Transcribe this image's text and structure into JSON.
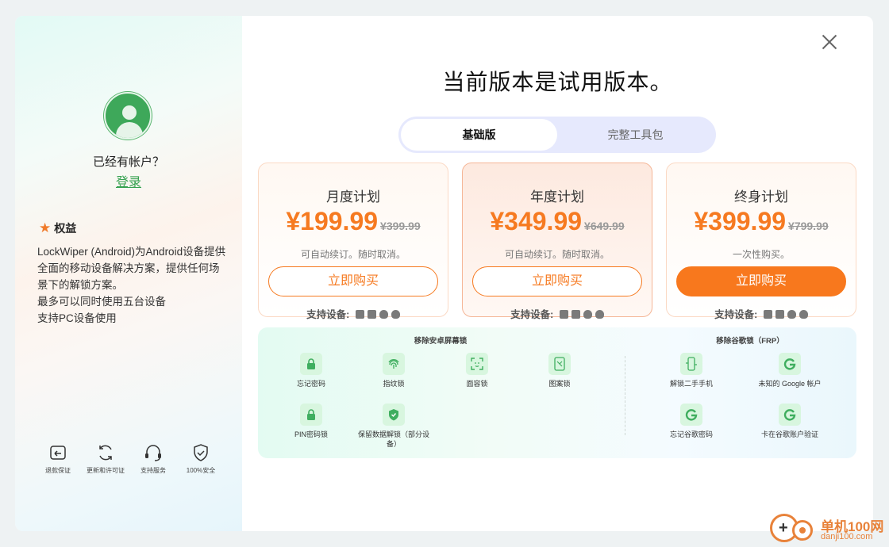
{
  "sidebar": {
    "has_account": "已经有帐户？",
    "login": "登录",
    "benefits_title": "权益",
    "benefits_lines": [
      "LockWiper (Android)为Android设备提供全面的移动设备解决方案，提供任何场景下的解锁方案。",
      "最多可以同时使用五台设备",
      "支持PC设备使用"
    ],
    "features": [
      {
        "label": "退款保证",
        "icon": "refund-icon"
      },
      {
        "label": "更新和许可证",
        "icon": "refresh-icon"
      },
      {
        "label": "支持服务",
        "icon": "headset-icon"
      },
      {
        "label": "100%安全",
        "icon": "shield-icon"
      }
    ]
  },
  "main": {
    "title": "当前版本是试用版本。",
    "tabs": [
      {
        "label": "基础版",
        "active": true
      },
      {
        "label": "完整工具包",
        "active": false
      }
    ],
    "devices_label": "支持设备:",
    "plans": [
      {
        "name": "月度计划",
        "price": "¥199.99",
        "old_price": "¥399.99",
        "note": "可自动续订。随时取消。",
        "button": "立即购买"
      },
      {
        "name": "年度计划",
        "price": "¥349.99",
        "old_price": "¥649.99",
        "note": "可自动续订。随时取消。",
        "button": "立即购买"
      },
      {
        "name": "终身计划",
        "price": "¥399.99",
        "old_price": "¥799.99",
        "note": "一次性购买。",
        "button": "立即购买"
      }
    ],
    "unlock": {
      "left_title": "移除安卓屏幕锁",
      "right_title": "移除谷歌锁（FRP）",
      "left_items": [
        {
          "label": "忘记密码",
          "icon": "lock-icon"
        },
        {
          "label": "指纹锁",
          "icon": "fingerprint-icon"
        },
        {
          "label": "面容锁",
          "icon": "face-scan-icon"
        },
        {
          "label": "图案锁",
          "icon": "pattern-icon"
        },
        {
          "label": "PIN密码锁",
          "icon": "pin-lock-icon"
        },
        {
          "label": "保留数据解锁（部分设备）",
          "icon": "shield-check-icon"
        }
      ],
      "right_items": [
        {
          "label": "解锁二手手机",
          "icon": "phone-icon"
        },
        {
          "label": "未知的 Google 帐户",
          "icon": "google-account-icon"
        },
        {
          "label": "忘记谷歌密码",
          "icon": "google-reset-icon"
        },
        {
          "label": "卡在谷歌账户验证",
          "icon": "google-icon"
        }
      ]
    }
  },
  "watermark": {
    "name": "单机100网",
    "url": "danji100.com"
  },
  "colors": {
    "accent_orange": "#f67a21",
    "login_green": "#35a150",
    "tab_bg": "#e6e9fd"
  }
}
